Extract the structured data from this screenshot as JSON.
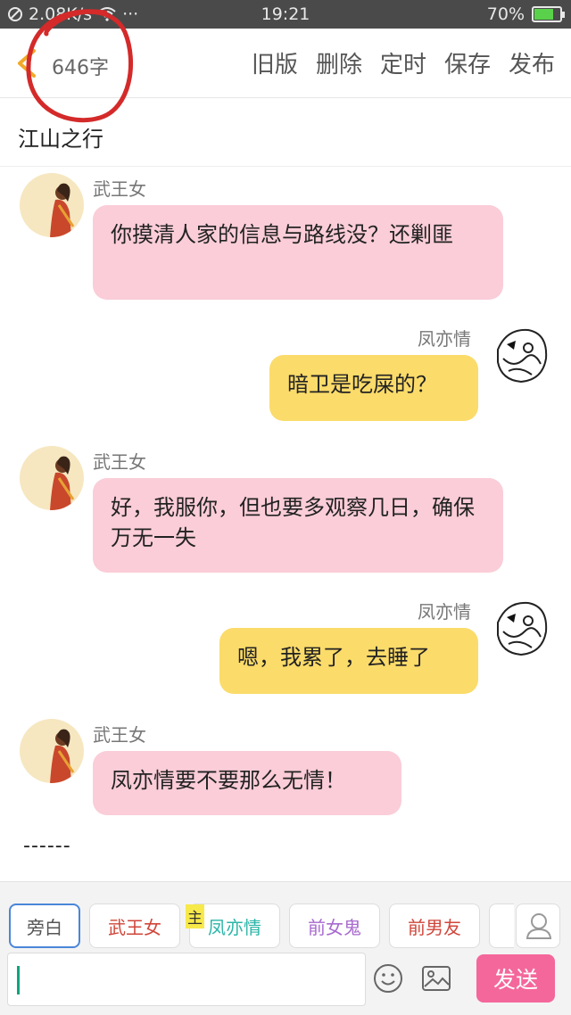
{
  "status_bar": {
    "network_speed": "2.08K/s",
    "more": "···",
    "time": "19:21",
    "battery": "70%",
    "battery_level": 0.7
  },
  "toolbar": {
    "word_count": "646字",
    "actions": [
      "旧版",
      "删除",
      "定时",
      "保存",
      "发布"
    ]
  },
  "story": {
    "title": "江山之行"
  },
  "messages": [
    {
      "speaker": "武王女",
      "side": "left",
      "text": "你摸清人家的信息与路线没？还剿匪",
      "color": "#facdd8"
    },
    {
      "speaker": "凤亦情",
      "side": "right",
      "text": "暗卫是吃屎的？",
      "color": "#fbdb6a"
    },
    {
      "speaker": "武王女",
      "side": "left",
      "text": "好，我服你，但也要多观察几日，确保万无一失",
      "color": "#facdd8"
    },
    {
      "speaker": "凤亦情",
      "side": "right",
      "text": "嗯，我累了，去睡了",
      "color": "#fbdb6a"
    },
    {
      "speaker": "武王女",
      "side": "left",
      "text": "凤亦情要不要那么无情！",
      "color": "#facdd8"
    }
  ],
  "trailing_text": "------",
  "characters": [
    {
      "label": "旁白",
      "color": "#555555"
    },
    {
      "label": "武王女",
      "color": "#d0463a"
    },
    {
      "label": "凤亦情",
      "color": "#2bb5a8"
    },
    {
      "label": "前女鬼",
      "color": "#a86ad0"
    },
    {
      "label": "前男友",
      "color": "#d0463a"
    }
  ],
  "host_tag": "主",
  "composer": {
    "send_label": "发送"
  },
  "colors": {
    "accent_send": "#f4679b",
    "bubble_left": "#facdd8",
    "bubble_right": "#fbdb6a",
    "active_chip": "#4a86d8"
  }
}
